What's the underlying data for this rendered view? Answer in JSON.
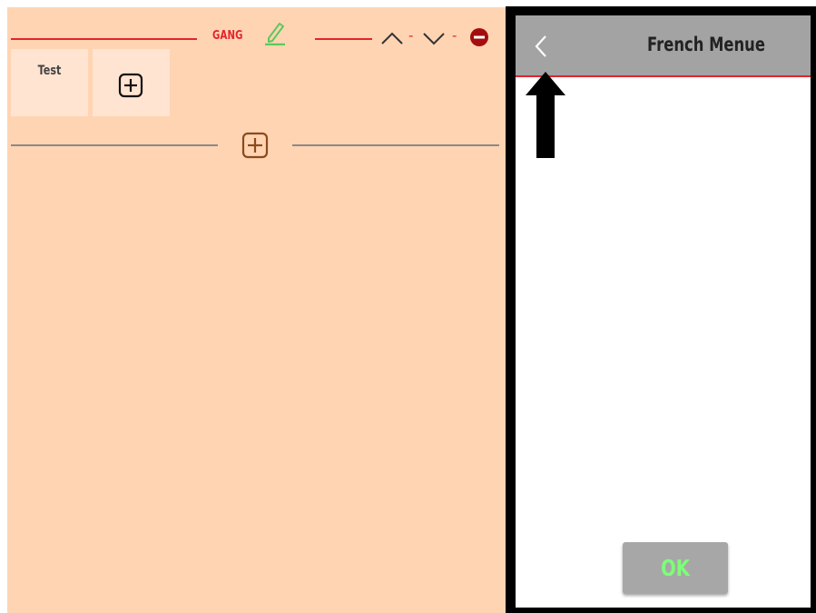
{
  "left_panel": {
    "group": {
      "title": "GANG"
    },
    "items": [
      {
        "label": "Test"
      }
    ],
    "icons": {
      "edit": "pencil-icon",
      "move_up": "chevron-up-icon",
      "move_down": "chevron-down-icon",
      "remove": "minus-circle-icon",
      "add_item": "plus-square-icon",
      "add_group": "plus-square-icon"
    },
    "separator": "-"
  },
  "modal": {
    "title": "French Menue",
    "back_icon": "chevron-left-icon",
    "ok_label": "OK"
  },
  "colors": {
    "panel_bg": "#ffd4b3",
    "tile_bg": "#ffe4d1",
    "accent_red": "#e3242b",
    "edit_green": "#5cc95c",
    "add_brown": "#8b4a1c",
    "modal_header": "#a3a3a3",
    "ok_text": "#7dff78"
  }
}
